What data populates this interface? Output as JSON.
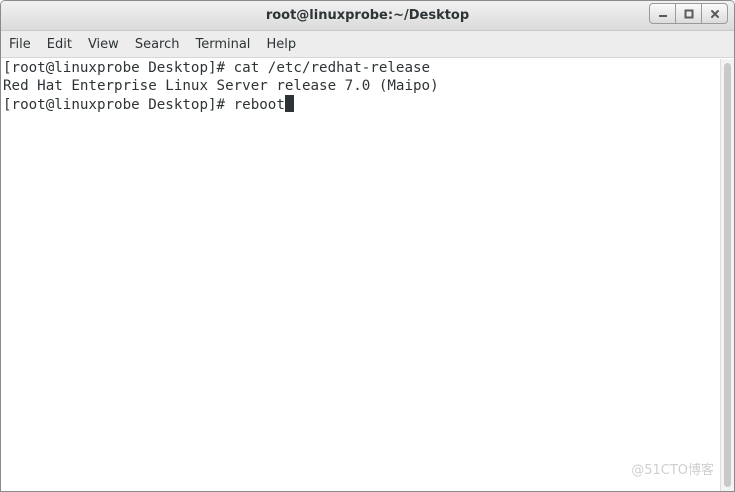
{
  "window": {
    "title": "root@linuxprobe:~/Desktop"
  },
  "controls": {
    "minimize_icon": "minimize-icon",
    "maximize_icon": "maximize-icon",
    "close_icon": "close-icon"
  },
  "menu": {
    "items": [
      "File",
      "Edit",
      "View",
      "Search",
      "Terminal",
      "Help"
    ]
  },
  "terminal": {
    "lines": [
      "[root@linuxprobe Desktop]# cat /etc/redhat-release",
      "Red Hat Enterprise Linux Server release 7.0 (Maipo)"
    ],
    "prompt": "[root@linuxprobe Desktop]# ",
    "current_input": "reboot"
  },
  "watermark": "@51CTO博客",
  "colors": {
    "terminal_text": "#2e3436",
    "terminal_bg": "#ffffff",
    "titlebar_bg": "#e4e4e4"
  }
}
